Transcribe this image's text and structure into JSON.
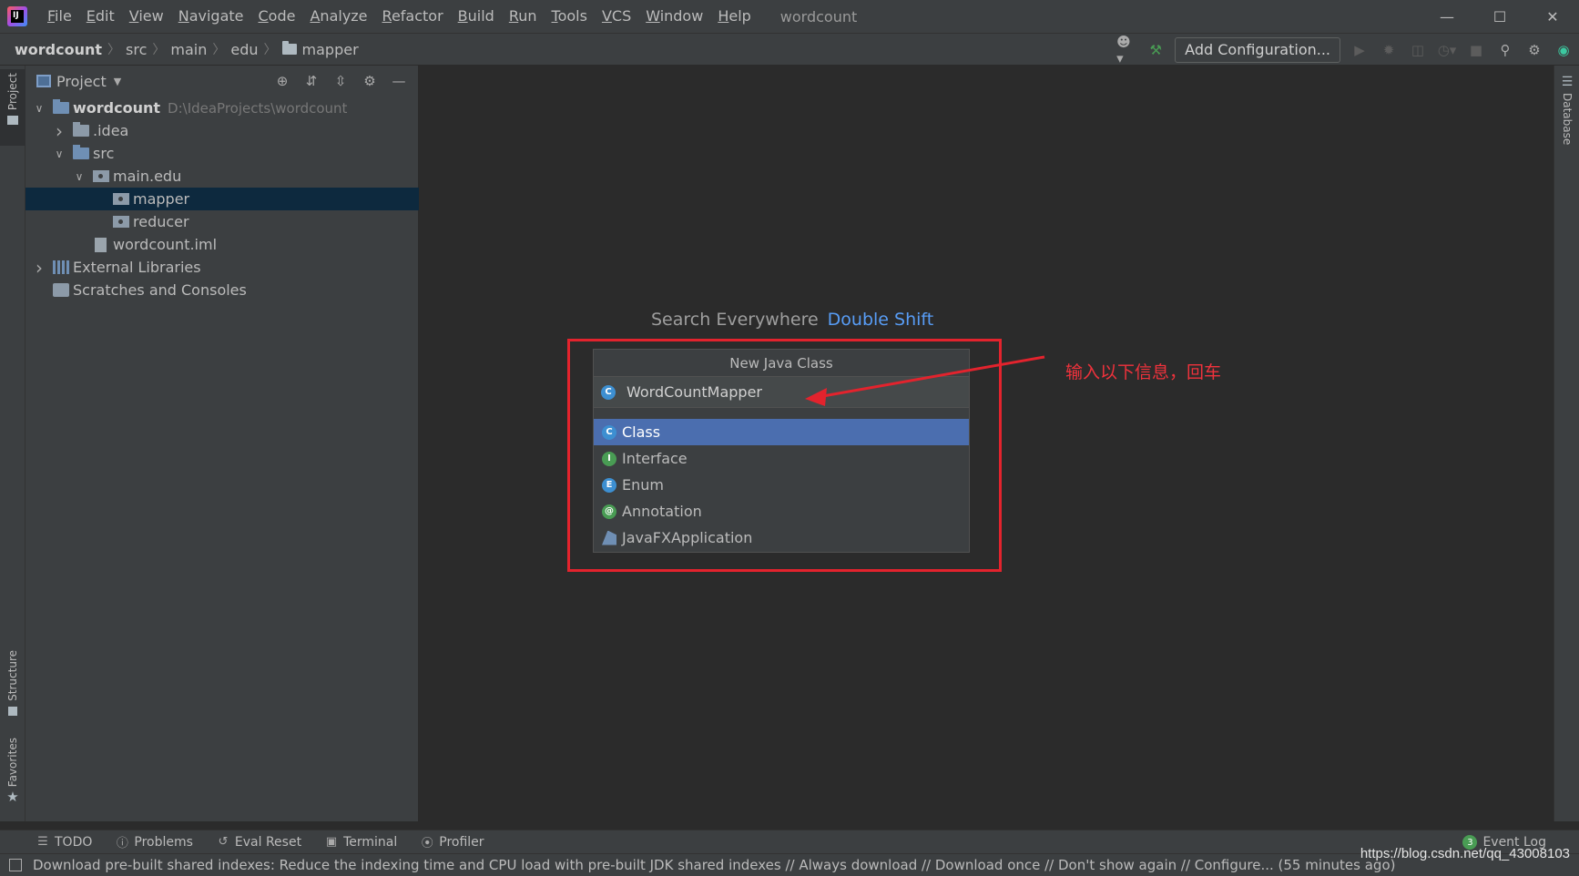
{
  "app": {
    "window_title": "wordcount",
    "menu": [
      "File",
      "Edit",
      "View",
      "Navigate",
      "Code",
      "Analyze",
      "Refactor",
      "Build",
      "Run",
      "Tools",
      "VCS",
      "Window",
      "Help"
    ]
  },
  "breadcrumb": [
    "wordcount",
    "src",
    "main",
    "edu",
    "mapper"
  ],
  "toolbar": {
    "add_configuration_label": "Add Configuration..."
  },
  "side_tabs": {
    "project": "Project",
    "structure": "Structure",
    "favorites": "Favorites",
    "database": "Database"
  },
  "project_panel": {
    "title": "Project",
    "tree": [
      {
        "label": "wordcount",
        "hint": "D:\\IdeaProjects\\wordcount",
        "depth": 0,
        "expanded": true,
        "icon": "module-folder-icon"
      },
      {
        "label": ".idea",
        "depth": 1,
        "expanded": false,
        "icon": "folder-icon"
      },
      {
        "label": "src",
        "depth": 1,
        "expanded": true,
        "icon": "source-folder-icon"
      },
      {
        "label": "main.edu",
        "depth": 2,
        "expanded": true,
        "icon": "package-icon"
      },
      {
        "label": "mapper",
        "depth": 3,
        "icon": "package-icon",
        "selected": true
      },
      {
        "label": "reducer",
        "depth": 3,
        "icon": "package-icon"
      },
      {
        "label": "wordcount.iml",
        "depth": 2,
        "icon": "iml-file-icon"
      },
      {
        "label": "External Libraries",
        "depth": 0,
        "expanded": false,
        "icon": "libraries-icon"
      },
      {
        "label": "Scratches and Consoles",
        "depth": 0,
        "icon": "scratches-icon"
      }
    ]
  },
  "editor": {
    "hint_label": "Search Everywhere",
    "hint_shortcut": "Double Shift"
  },
  "new_class_popup": {
    "title": "New Java Class",
    "input_value": "WordCountMapper",
    "options": [
      {
        "label": "Class",
        "badge": "C",
        "color": "#3d8fd1",
        "selected": true
      },
      {
        "label": "Interface",
        "badge": "I",
        "color": "#499c54"
      },
      {
        "label": "Enum",
        "badge": "E",
        "color": "#3d8fd1"
      },
      {
        "label": "Annotation",
        "badge": "@",
        "color": "#499c54"
      },
      {
        "label": "JavaFXApplication",
        "badge": "fx"
      }
    ]
  },
  "annotation": {
    "note": "输入以下信息，回车",
    "color": "#e3232d"
  },
  "bottom_tabs": [
    "TODO",
    "Problems",
    "Eval Reset",
    "Terminal",
    "Profiler"
  ],
  "event_log": {
    "count": "3",
    "label": "Event Log"
  },
  "status_message": "Download pre-built shared indexes: Reduce the indexing time and CPU load with pre-built JDK shared indexes // Always download // Download once // Don't show again // Configure... (55 minutes ago)",
  "watermark": "https://blog.csdn.net/qq_43008103"
}
